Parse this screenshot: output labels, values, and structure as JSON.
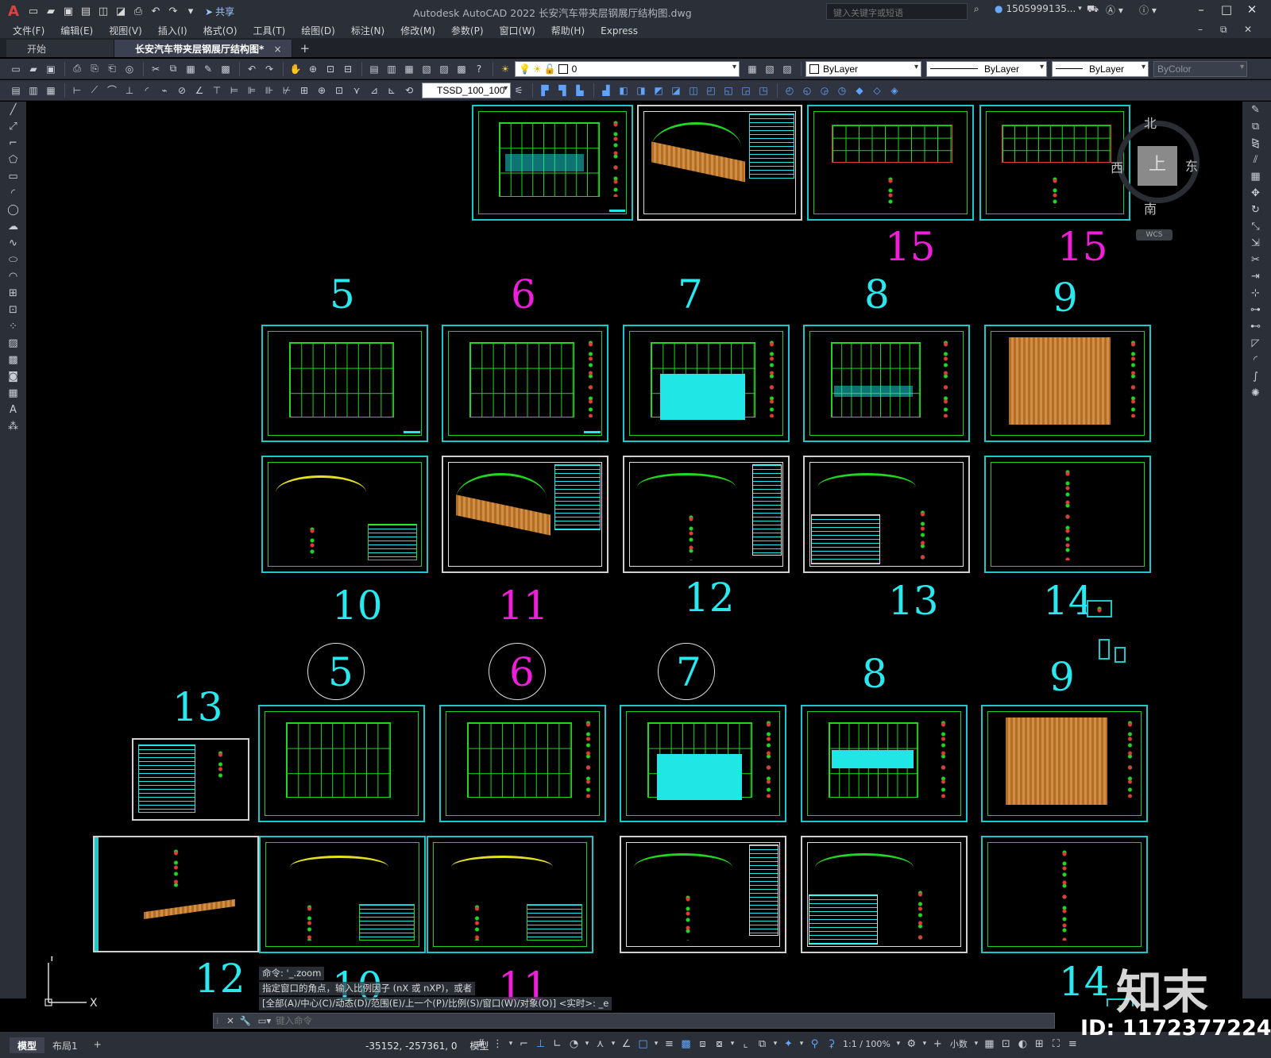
{
  "app": {
    "title": "Autodesk AutoCAD 2022    长安汽车带夹层钢展厅结构图.dwg",
    "search_placeholder": "键入关键字或短语",
    "user": "1505999135...",
    "share_label": "共享"
  },
  "menu": [
    "文件(F)",
    "编辑(E)",
    "视图(V)",
    "插入(I)",
    "格式(O)",
    "工具(T)",
    "绘图(D)",
    "标注(N)",
    "修改(M)",
    "参数(P)",
    "窗口(W)",
    "帮助(H)",
    "Express"
  ],
  "tabs": {
    "start": "开始",
    "document": "长安汽车带夹层钢展厅结构图*",
    "close": "×",
    "add": "+"
  },
  "properties": {
    "layer": "0",
    "color": "ByLayer",
    "linetype": "ByLayer",
    "lineweight": "ByLayer",
    "plotstyle": "ByColor",
    "dimstyle": "TSSD_100_100"
  },
  "viewcube": {
    "north": "北",
    "south": "南",
    "east": "东",
    "west": "西",
    "top": "上",
    "wcs": "WCS"
  },
  "drawing_labels": {
    "row0": [
      "15",
      "15"
    ],
    "row1_top": [
      "5",
      "6",
      "7",
      "8",
      "9"
    ],
    "row1_bottom": [
      "10",
      "11",
      "12",
      "13",
      "14"
    ],
    "row2_top": [
      "5",
      "6",
      "7",
      "8",
      "9"
    ],
    "left_label": "13",
    "row2_bottom": [
      "12",
      "10",
      "11",
      "14"
    ]
  },
  "command": {
    "history": [
      "命令: '_.zoom",
      "指定窗口的角点，输入比例因子 (nX 或 nXP)，或者",
      "[全部(A)/中心(C)/动态(D)/范围(E)/上一个(P)/比例(S)/窗口(W)/对象(O)] <实时>: _e"
    ],
    "placeholder": "键入命令"
  },
  "ucs": {
    "x": "X",
    "y": "Y"
  },
  "status": {
    "model_tab": "模型",
    "layout_tab": "布局1",
    "add": "+",
    "coords": "-35152, -257361, 0",
    "space": "模型",
    "scale": "1:1 / 100%",
    "units": "小数"
  },
  "watermark": {
    "logo": "知末",
    "id": "ID: 1172377224"
  }
}
